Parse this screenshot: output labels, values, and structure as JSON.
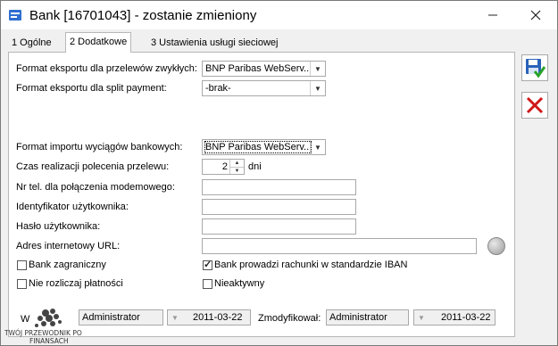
{
  "window": {
    "title": "Bank [16701043] - zostanie zmieniony"
  },
  "tabs": [
    {
      "label": "1 Ogólne",
      "active": false
    },
    {
      "label": "2 Dodatkowe",
      "active": true
    },
    {
      "label": "3 Ustawienia usługi sieciowej",
      "active": false
    }
  ],
  "form": {
    "export_normal_label": "Format eksportu dla przelewów zwykłych:",
    "export_normal_value": "BNP Paribas WebServ...",
    "export_split_label": "Format eksportu dla split payment:",
    "export_split_value": "-brak-",
    "import_label": "Format importu wyciągów bankowych:",
    "import_value": "BNP Paribas WebServ...",
    "time_label": "Czas realizacji polecenia przelewu:",
    "time_value": "2",
    "time_unit": "dni",
    "phone_label": "Nr tel. dla połączenia modemowego:",
    "phone_value": "",
    "user_id_label": "Identyfikator użytkownika:",
    "user_id_value": "",
    "password_label": "Hasło użytkownika:",
    "password_value": "",
    "url_label": "Adres internetowy URL:",
    "url_value": "",
    "foreign_bank_label": "Bank zagraniczny",
    "foreign_bank_checked": false,
    "iban_label": "Bank prowadzi rachunki w standardzie IBAN",
    "iban_checked": true,
    "no_settle_label": "Nie rozliczaj płatności",
    "no_settle_checked": false,
    "inactive_label": "Nieaktywny",
    "inactive_checked": false
  },
  "footer": {
    "added_label_visible": "W",
    "added_user": "Administrator",
    "added_date": "2011-03-22",
    "modified_label": "Zmodyfikował:",
    "modified_user": "Administrator",
    "modified_date": "2011-03-22"
  },
  "watermark": {
    "text_line1": "TWÓJ PRZEWODNIK PO",
    "text_line2": "FINANSACH"
  },
  "icons": {
    "save": "save-disk-check-icon",
    "cancel": "red-x-icon",
    "globe": "globe-icon",
    "minimize": "minimize-icon",
    "close": "close-icon"
  },
  "colors": {
    "accent_blue": "#2a62b8",
    "cancel_red": "#d01818",
    "check_green": "#2aa32a"
  }
}
